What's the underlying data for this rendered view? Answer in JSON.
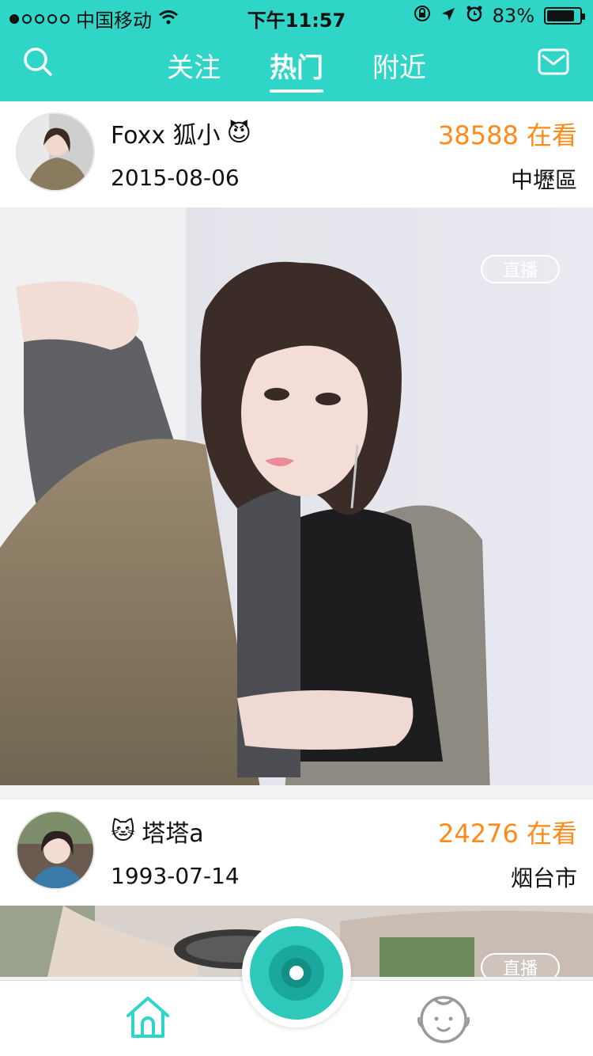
{
  "status": {
    "carrier": "中国移动",
    "time": "下午11:57",
    "battery_percent": "83%",
    "signal_dots_filled": 1,
    "signal_dots_total": 5
  },
  "nav": {
    "tabs": [
      {
        "label": "关注",
        "active": false
      },
      {
        "label": "热门",
        "active": true
      },
      {
        "label": "附近",
        "active": false
      }
    ],
    "search_icon": "search-icon",
    "message_icon": "mail-icon"
  },
  "feed": [
    {
      "name": "Foxx 狐小",
      "emoji": "😈",
      "date": "2015-08-06",
      "viewers": "38588 在看",
      "city": "中壢區",
      "badge": "直播"
    },
    {
      "name": "塔塔a",
      "emoji": "🐱",
      "date": "1993-07-14",
      "viewers": "24276 在看",
      "city": "烟台市",
      "badge": "直播"
    }
  ],
  "bottom": {
    "home_icon": "home-icon",
    "live_icon": "live-camera-button",
    "me_icon": "profile-face-icon"
  },
  "colors": {
    "accent": "#2fd6c8",
    "viewers": "#ff8a1a"
  }
}
